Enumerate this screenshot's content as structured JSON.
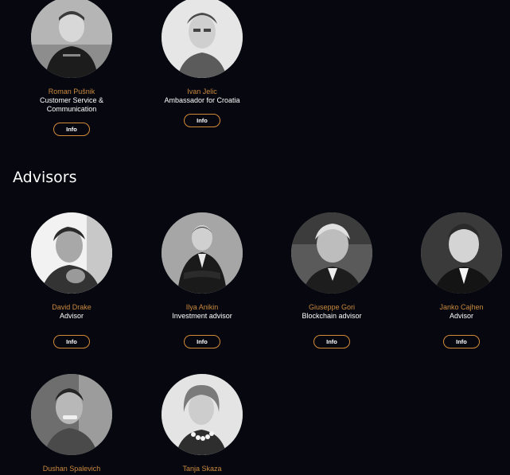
{
  "team": [
    {
      "name": "Roman Pušnik",
      "role_lines": [
        "Customer Service &",
        "Communication"
      ],
      "button": "Info"
    },
    {
      "name": "Ivan Jelic",
      "role_lines": [
        "Ambassador for Croatia"
      ],
      "button": "Info"
    }
  ],
  "advisors_section": {
    "title": "Advisors",
    "members": [
      {
        "name": "David Drake",
        "role": "Advisor",
        "button": "Info"
      },
      {
        "name": "Ilya Anikin",
        "role": "Investment advisor",
        "button": "Info"
      },
      {
        "name": "Giuseppe Gori",
        "role": "Blockchain advisor",
        "button": "Info"
      },
      {
        "name": "Janko Cajhen",
        "role": "Advisor",
        "button": "Info"
      },
      {
        "name": "Dushan Spalevich"
      },
      {
        "name": "Tanja Skaza"
      }
    ]
  },
  "colors": {
    "background": "#070710",
    "name_accent": "#c98a3e",
    "button_border": "#d38a36"
  }
}
